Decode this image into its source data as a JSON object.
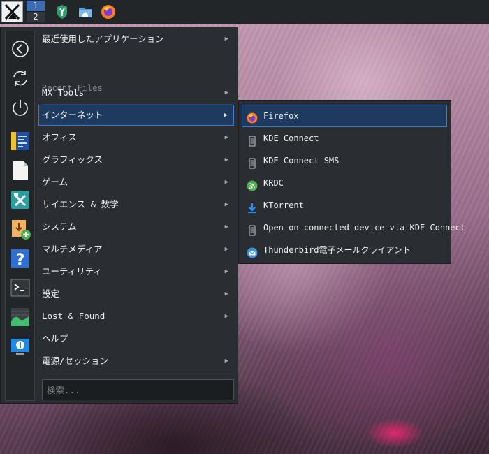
{
  "panel": {
    "workspaces": [
      "1",
      "2"
    ],
    "launchers": [
      {
        "name": "mx-tweak-icon"
      },
      {
        "name": "home-folder-icon"
      },
      {
        "name": "firefox-icon"
      }
    ]
  },
  "menu": {
    "items": [
      {
        "label": "最近使用したアプリケーション",
        "has_submenu": true
      },
      {
        "label": "MX Tools",
        "has_submenu": true
      },
      {
        "label": "インターネット",
        "has_submenu": true,
        "selected": true
      },
      {
        "label": "オフィス",
        "has_submenu": true
      },
      {
        "label": "グラフィックス",
        "has_submenu": true
      },
      {
        "label": "ゲーム",
        "has_submenu": true
      },
      {
        "label": "サイエンス & 数学",
        "has_submenu": true
      },
      {
        "label": "システム",
        "has_submenu": true
      },
      {
        "label": "マルチメディア",
        "has_submenu": true
      },
      {
        "label": "ユーティリティ",
        "has_submenu": true
      },
      {
        "label": "設定",
        "has_submenu": true
      },
      {
        "label": "Lost & Found",
        "has_submenu": true
      },
      {
        "label": "ヘルプ",
        "has_submenu": false
      },
      {
        "label": "電源/セッション",
        "has_submenu": true
      }
    ],
    "recent_files_label": "Recent Files",
    "search_placeholder": "検索...",
    "favorites": [
      "back-icon",
      "refresh-icon",
      "power-icon",
      "ide-icon",
      "document-icon",
      "mx-tools-icon",
      "installer-icon",
      "help-icon",
      "terminal-icon",
      "system-monitor-icon",
      "system-info-icon"
    ]
  },
  "submenu": {
    "title": "インターネット",
    "items": [
      {
        "label": "Firefox",
        "icon": "firefox-icon",
        "selected": true
      },
      {
        "label": "KDE Connect",
        "icon": "phone-icon"
      },
      {
        "label": "KDE Connect SMS",
        "icon": "phone-icon"
      },
      {
        "label": "KRDC",
        "icon": "krdc-icon"
      },
      {
        "label": "KTorrent",
        "icon": "download-icon"
      },
      {
        "label": "Open on connected device via KDE Connect",
        "icon": "phone-icon"
      },
      {
        "label": "Thunderbird電子メールクライアント",
        "icon": "thunderbird-icon"
      }
    ]
  },
  "colors": {
    "accent": "#3d7ad1",
    "selection_bg": "#1e3a5e",
    "menu_bg": "#2a2e32",
    "panel_bg": "#232629"
  }
}
